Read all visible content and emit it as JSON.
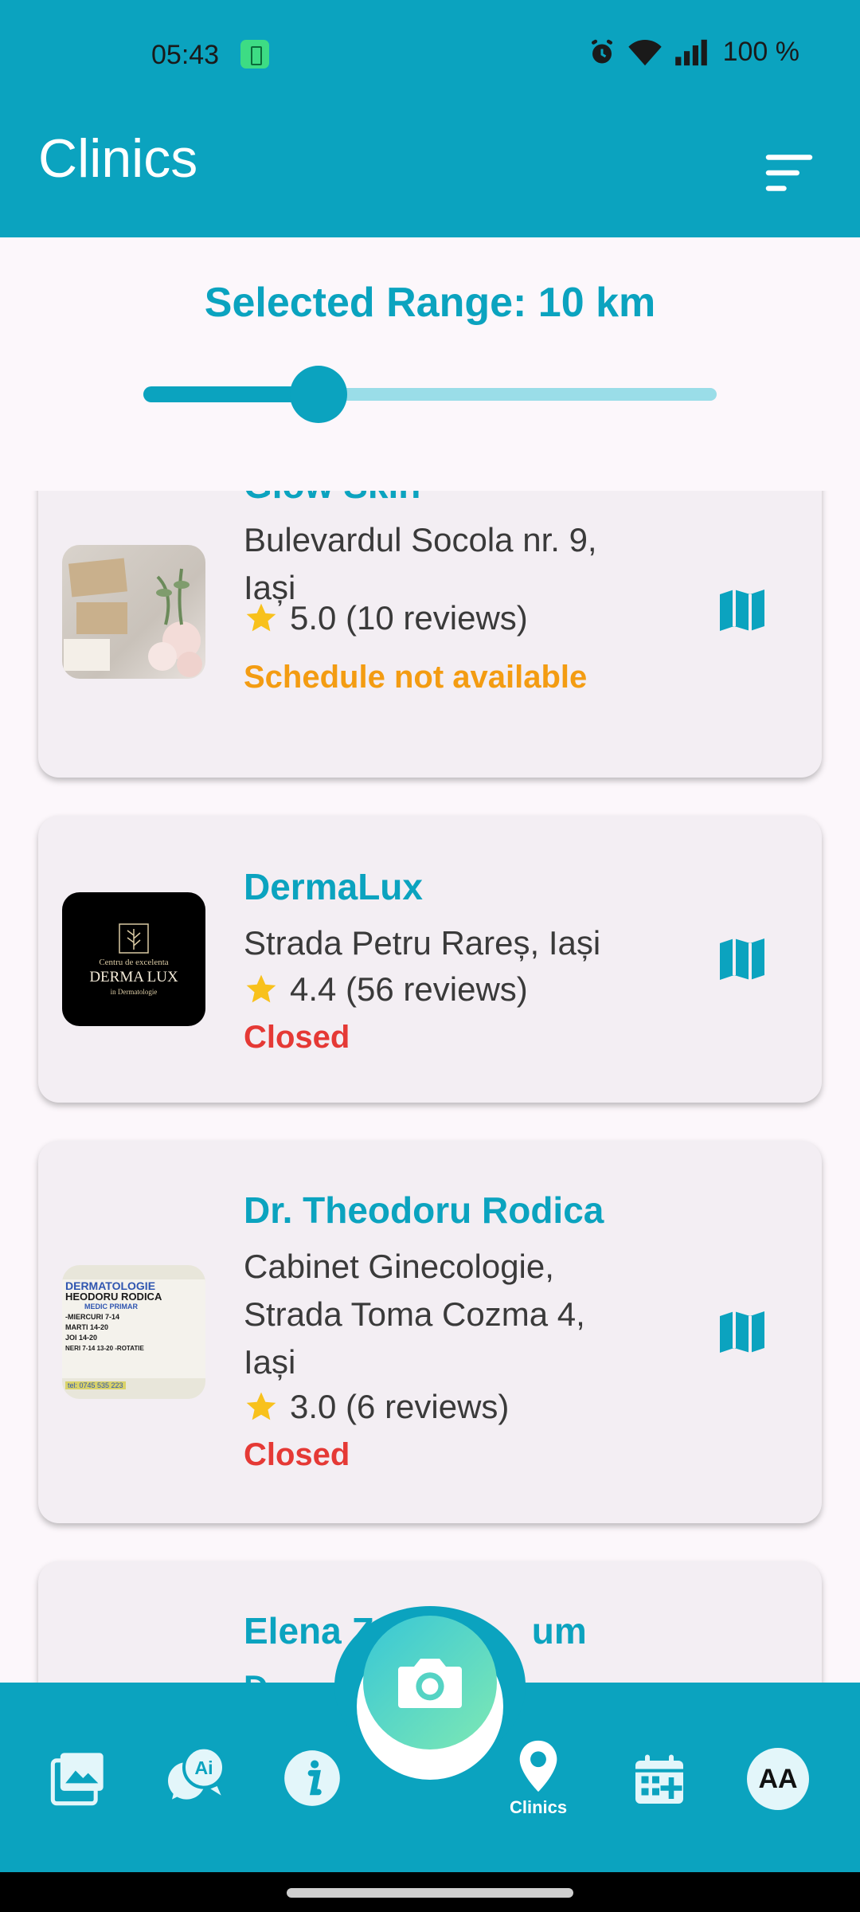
{
  "status_bar": {
    "time": "05:43",
    "battery": "100 %"
  },
  "app_bar": {
    "title": "Clinics"
  },
  "range": {
    "label": "Selected Range: 10 km",
    "value_km": 10,
    "slider_fraction": 0.18
  },
  "clinics": [
    {
      "name": "Glow Skin",
      "address": "Bulevardul Socola nr. 9, Iași",
      "rating": "5.0 (10 reviews)",
      "status": "Schedule not available",
      "status_color": "#F39C12"
    },
    {
      "name": "DermaLux",
      "address": "Strada Petru Rareș, Iași",
      "rating": "4.4 (56 reviews)",
      "status": "Closed",
      "status_color": "#E53935",
      "logo": {
        "line1": "Centru de excelenta",
        "line2": "DERMA LUX",
        "line3": "in Dermatologie"
      }
    },
    {
      "name": "Dr. Theodoru Rodica",
      "address": "Cabinet Ginecologie, Strada Toma Cozma 4, Iași",
      "rating": "3.0 (6 reviews)",
      "status": "Closed",
      "status_color": "#E53935",
      "sign": {
        "line1": "DERMATOLOGIE",
        "line2": "HEODORU RODICA",
        "line3": "MEDIC PRIMAR",
        "line4": "-MIERCURI  7-14",
        "line5": "MARTI  14-20",
        "line6": "JOI  14-20",
        "line7": "NERI 7-14  13-20 -ROTATIE",
        "line8": "tel: 0745 535 223"
      }
    },
    {
      "name": "Elena Zo...um",
      "name_partial_top": "Elena Zo",
      "name_partial_end": "um",
      "address_partial": "D..."
    }
  ],
  "bottom_nav": {
    "items": [
      {
        "icon": "gallery-icon"
      },
      {
        "icon": "ai-chat-icon"
      },
      {
        "icon": "info-icon"
      },
      {
        "icon": "camera-icon"
      },
      {
        "icon": "location-pin-icon",
        "label": "Clinics",
        "active": true
      },
      {
        "icon": "calendar-add-icon"
      },
      {
        "icon": "text-size-icon",
        "label": "AA"
      }
    ],
    "clinics_label": "Clinics",
    "avatar_text": "AA"
  },
  "colors": {
    "primary": "#0BA3BF",
    "slider_inactive": "#9ADDE8",
    "card_bg": "#F3EEF3",
    "page_bg": "#FCF7FB",
    "star": "#F8C11C"
  }
}
